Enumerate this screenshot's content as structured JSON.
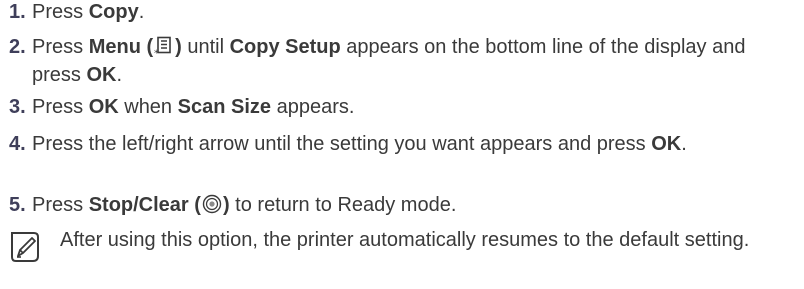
{
  "steps": [
    {
      "num": "1.",
      "parts": [
        "Press ",
        "Copy",
        "."
      ]
    },
    {
      "num": "2.",
      "parts": [
        "Press ",
        "Menu (",
        ")",
        " until ",
        "Copy Setup",
        " appears on the bottom line of the display and press ",
        "OK",
        "."
      ],
      "icon": "menu-icon"
    },
    {
      "num": "3.",
      "parts": [
        "Press ",
        "OK",
        " when ",
        "Scan Size",
        " appears."
      ]
    },
    {
      "num": "4.",
      "parts": [
        "Press the left/right arrow until the setting you want appears and press ",
        "OK",
        "."
      ]
    },
    {
      "num": "5.",
      "parts": [
        "Press ",
        "Stop/Clear (",
        ")",
        " to return to Ready mode."
      ],
      "icon": "stop-clear-icon"
    }
  ],
  "note": {
    "icon": "note-pencil-icon",
    "text": "After using this option, the printer automatically resumes to the default setting."
  }
}
